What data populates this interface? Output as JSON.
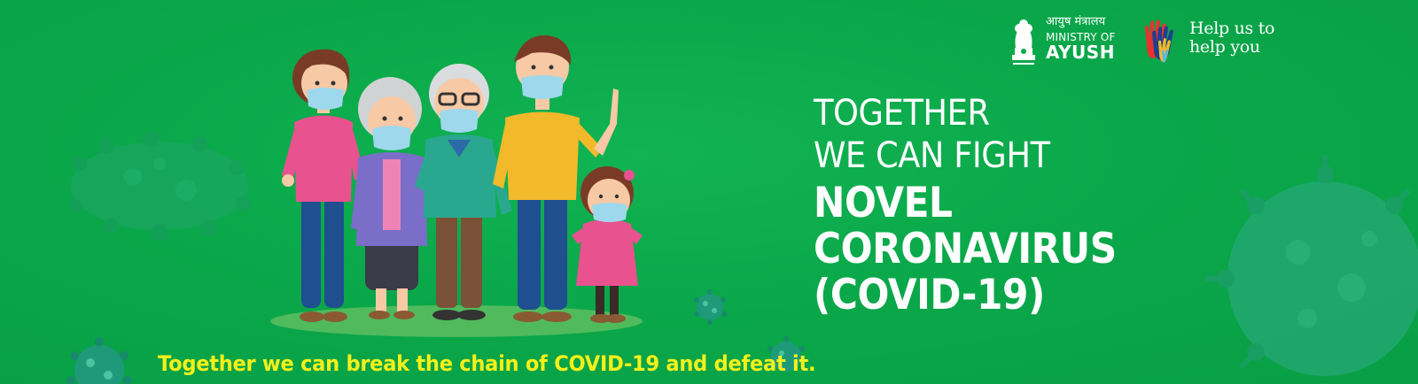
{
  "headline": {
    "line1": "TOGETHER",
    "line2": "WE CAN FIGHT",
    "line3": "NOVEL",
    "line4": "CORONAVIRUS",
    "line5": "(COVID-19)"
  },
  "tagline": "Together we can break the chain of COVID-19 and defeat it.",
  "ministry_logo": {
    "hindi": "आयुष मंत्रालय",
    "ministry_of": "MINISTRY OF",
    "name": "AYUSH"
  },
  "help_logo": {
    "line1": "Help us to",
    "line2": "help you"
  },
  "colors": {
    "background": "#0aa84a",
    "headline_text": "#ffffff",
    "tagline_text": "#f5f019",
    "virus": "#1f9b78"
  },
  "icons": [
    "coronavirus-icon",
    "family-illustration",
    "national-emblem-icon",
    "helping-hands-icon"
  ]
}
